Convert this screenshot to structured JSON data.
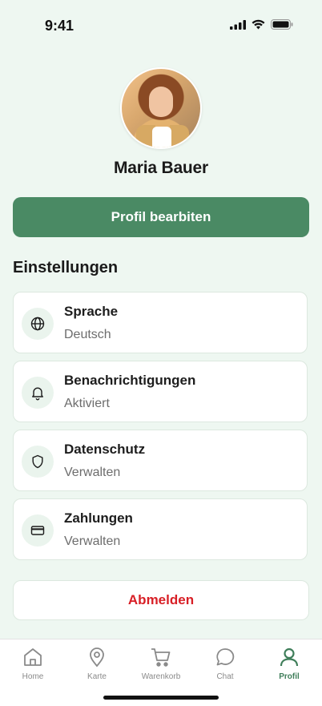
{
  "status_bar": {
    "time": "9:41"
  },
  "profile": {
    "name": "Maria Bauer"
  },
  "edit_button_label": "Profil bearbiten",
  "settings": {
    "title": "Einstellungen",
    "items": [
      {
        "label": "Sprache",
        "value": "Deutsch",
        "icon": "globe-icon"
      },
      {
        "label": "Benachrichtigungen",
        "value": "Aktiviert",
        "icon": "bell-icon"
      },
      {
        "label": "Datenschutz",
        "value": "Verwalten",
        "icon": "shield-icon"
      },
      {
        "label": "Zahlungen",
        "value": "Verwalten",
        "icon": "credit-card-icon"
      }
    ]
  },
  "logout_label": "Abmelden",
  "tabbar": {
    "tabs": [
      {
        "label": "Home",
        "icon": "home-icon",
        "active": false
      },
      {
        "label": "Karte",
        "icon": "map-pin-icon",
        "active": false
      },
      {
        "label": "Warenkorb",
        "icon": "cart-icon",
        "active": false
      },
      {
        "label": "Chat",
        "icon": "chat-bubble-icon",
        "active": false
      },
      {
        "label": "Profil",
        "icon": "user-icon",
        "active": true
      }
    ]
  },
  "colors": {
    "background": "#eef7f1",
    "accent": "#4a8a64",
    "active_tab": "#3f7e5a",
    "danger": "#d81f26"
  }
}
